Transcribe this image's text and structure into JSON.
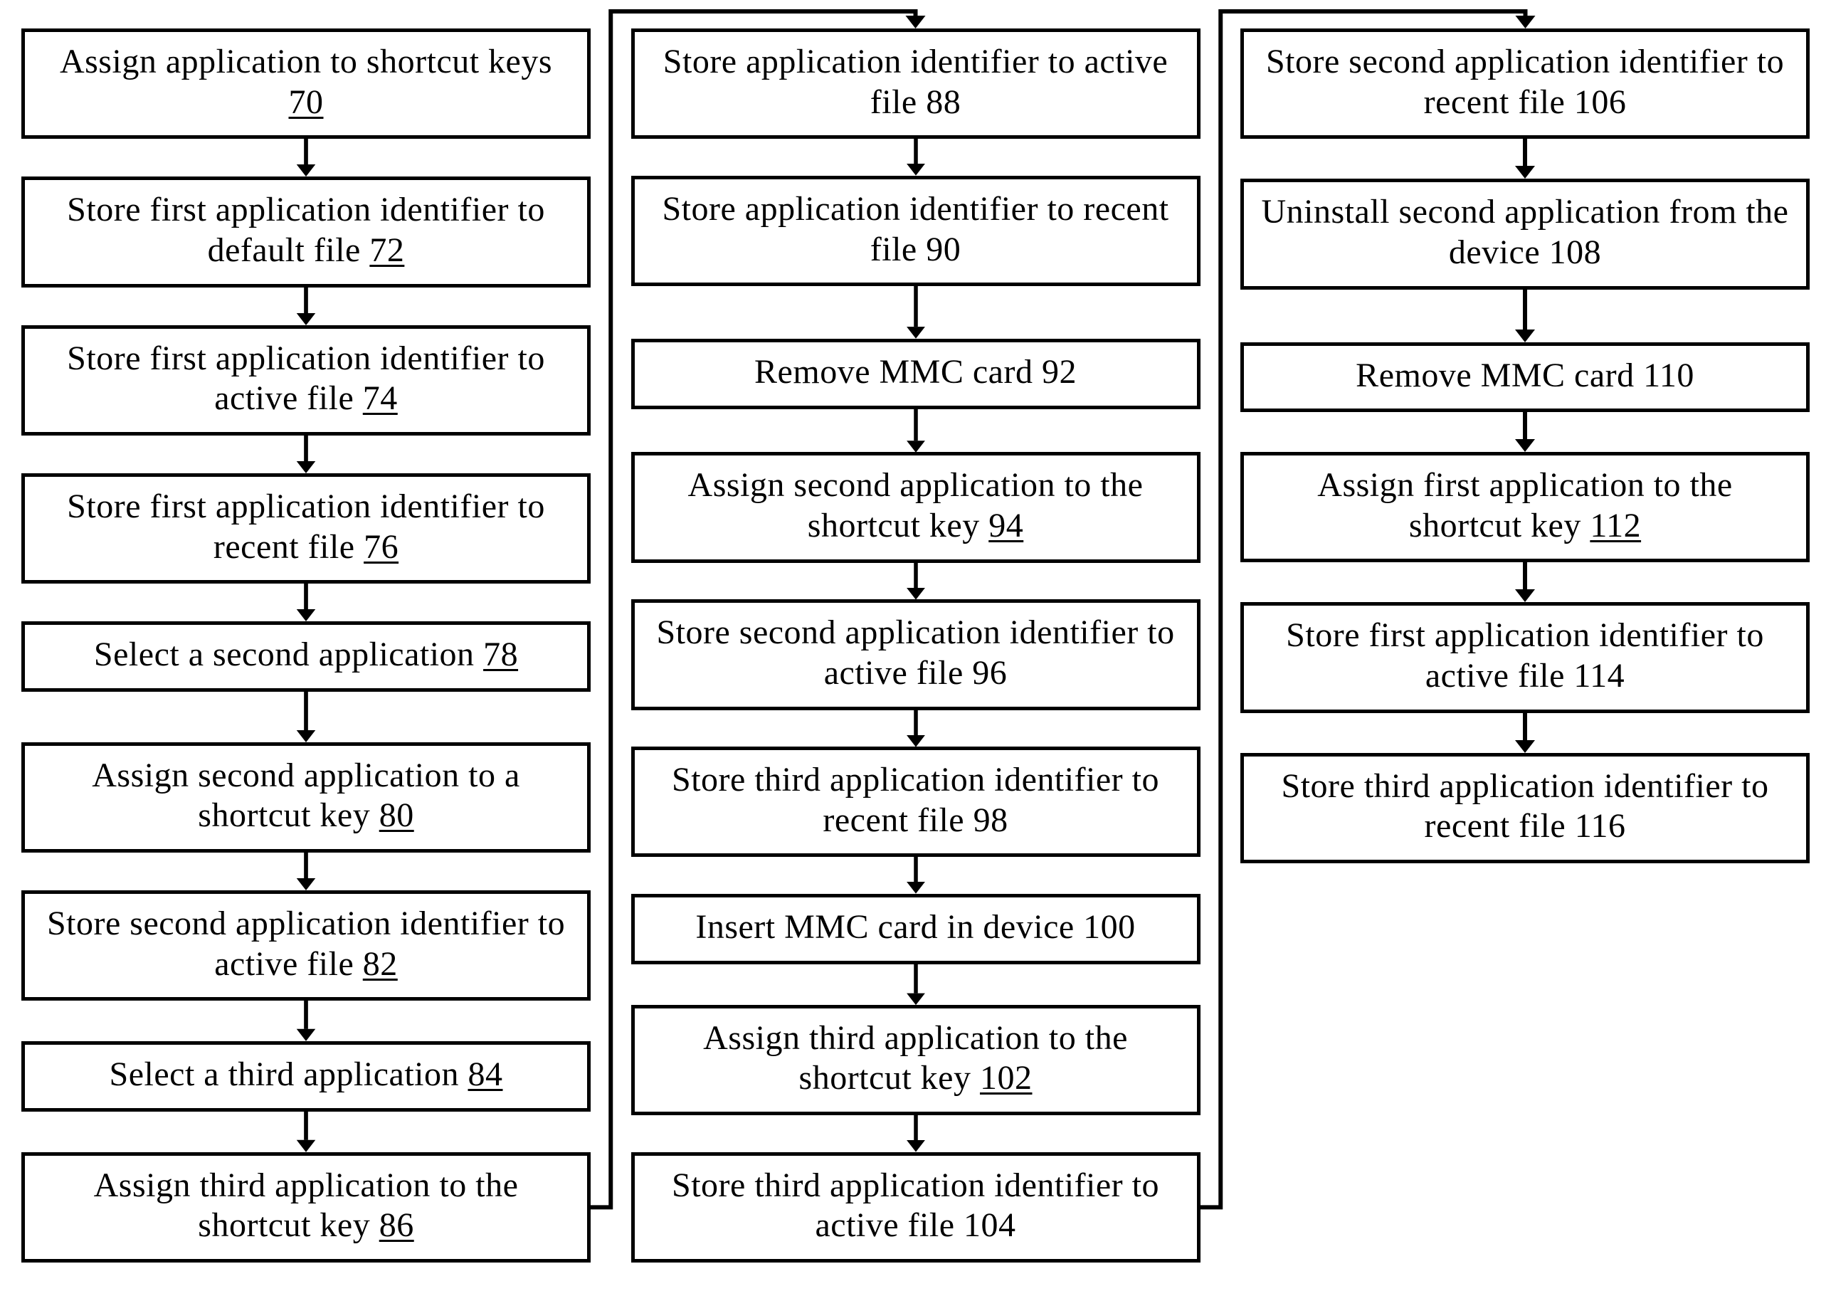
{
  "col1": [
    {
      "text": "Assign application to shortcut keys ",
      "ref": "70",
      "underline": true
    },
    {
      "text": "Store first application identifier to default file ",
      "ref": "72",
      "underline": true
    },
    {
      "text": "Store first application identifier to active file ",
      "ref": "74",
      "underline": true
    },
    {
      "text": "Store first application identifier to recent file ",
      "ref": "76",
      "underline": true
    },
    {
      "text": "Select a second application ",
      "ref": "78",
      "underline": true
    },
    {
      "text": "Assign second application to a shortcut key ",
      "ref": "80",
      "underline": true
    },
    {
      "text": "Store second application identifier to active file ",
      "ref": "82",
      "underline": true
    },
    {
      "text": "Select a third application ",
      "ref": "84",
      "underline": true
    },
    {
      "text": "Assign third application to the shortcut key ",
      "ref": "86",
      "underline": true
    }
  ],
  "col2": [
    {
      "text": "Store application identifier to active file ",
      "ref": "88",
      "underline": false
    },
    {
      "text": "Store application identifier to recent file ",
      "ref": "90",
      "underline": false
    },
    {
      "text": "Remove MMC card ",
      "ref": "92",
      "underline": false
    },
    {
      "text": "Assign second application to the shortcut key ",
      "ref": "94",
      "underline": true
    },
    {
      "text": "Store second application identifier to active file ",
      "ref": "96",
      "underline": false
    },
    {
      "text": "Store third application identifier to recent file ",
      "ref": "98",
      "underline": false
    },
    {
      "text": "Insert MMC card in device ",
      "ref": "100",
      "underline": false
    },
    {
      "text": "Assign third application to the shortcut key ",
      "ref": "102",
      "underline": true
    },
    {
      "text": "Store third application identifier to active file ",
      "ref": "104",
      "underline": false
    }
  ],
  "col3": [
    {
      "text": "Store second application identifier to recent file ",
      "ref": "106",
      "underline": false
    },
    {
      "text": "Uninstall second application from the device ",
      "ref": "108",
      "underline": false
    },
    {
      "text": "Remove MMC card ",
      "ref": "110",
      "underline": false
    },
    {
      "text": "Assign first application to the shortcut key ",
      "ref": "112",
      "underline": true
    },
    {
      "text": "Store first application identifier to active file ",
      "ref": "114",
      "underline": false
    },
    {
      "text": "Store third application identifier to recent file ",
      "ref": "116",
      "underline": false
    }
  ],
  "layout": {
    "arrow_height_default": 55,
    "arrow_height_col1": [
      56,
      56,
      56,
      56,
      75,
      56,
      60,
      60
    ],
    "arrow_height_col2": [
      56,
      80,
      66,
      56,
      56,
      56,
      62,
      56
    ],
    "arrow_height_col3": [
      56,
      74,
      56,
      56,
      56
    ]
  }
}
